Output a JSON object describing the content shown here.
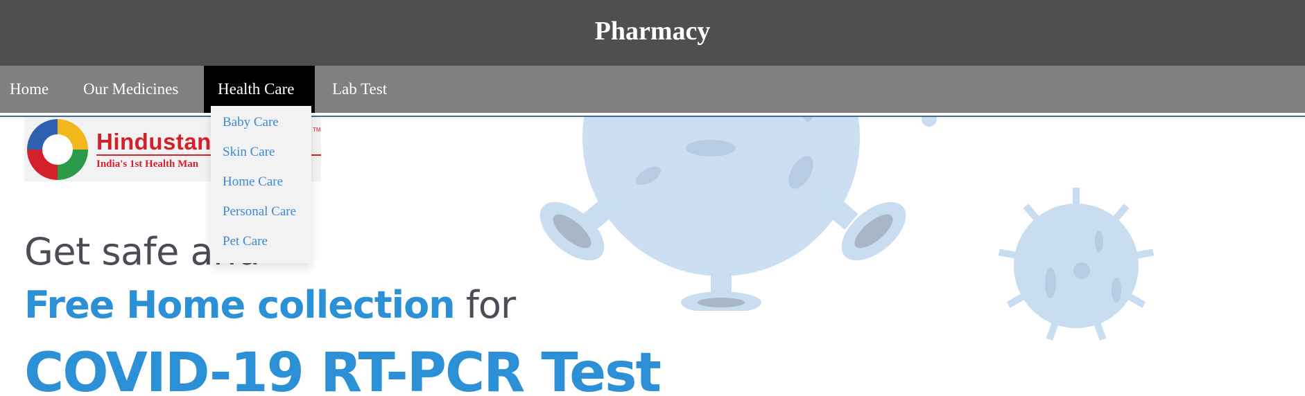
{
  "header": {
    "title": "Pharmacy"
  },
  "nav": {
    "items": [
      {
        "label": "Home"
      },
      {
        "label": "Our Medicines"
      },
      {
        "label": "Health Care",
        "active": true
      },
      {
        "label": "Lab Test"
      }
    ],
    "dropdown": [
      "Baby Care",
      "Skin Care",
      "Home Care",
      "Personal Care",
      "Pet Care"
    ]
  },
  "banner": {
    "logo": {
      "name": "Hindustan",
      "tagline": "India's 1st Health Man",
      "icon": "hindustan-logo-icon"
    },
    "headline_line1": "Get safe and",
    "headline_line2_highlight": "Free Home collection",
    "headline_line2_rest": "for",
    "headline_line3": "COVID-19 RT-PCR Test"
  },
  "colors": {
    "header_bg": "#4f4f4f",
    "nav_bg": "#808080",
    "nav_active_bg": "#000000",
    "dropdown_bg": "#f2f2f2",
    "link": "#3a8ad4",
    "accent_blue": "#2b90d6",
    "dark_text": "#4a4d55",
    "virus": "#c9ddf1"
  }
}
